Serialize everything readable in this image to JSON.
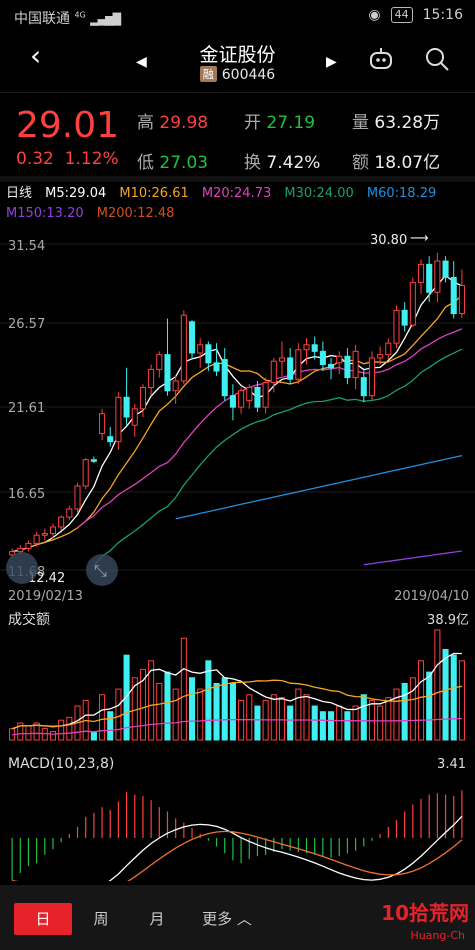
{
  "status": {
    "carrier": "中国联通",
    "network": "4G",
    "battery": "44",
    "time": "15:16"
  },
  "header": {
    "title": "金证股份",
    "badge": "融",
    "code": "600446"
  },
  "quote": {
    "price": "29.01",
    "change": "0.32",
    "change_pct": "1.12%",
    "high_label": "高",
    "high": "29.98",
    "open_label": "开",
    "open": "27.19",
    "volume_label": "量",
    "volume": "63.28万",
    "low_label": "低",
    "low": "27.03",
    "turnover_label": "换",
    "turnover": "7.42%",
    "amount_label": "额",
    "amount": "18.07亿"
  },
  "ma_bar": {
    "period": "日线",
    "m5": "M5:29.04",
    "m10": "M10:26.61",
    "m20": "M20:24.73",
    "m30": "M30:24.00",
    "m60": "M60:18.29",
    "m150": "M150:13.20",
    "m200": "M200:12.48"
  },
  "colors": {
    "m5": "#ffffff",
    "m10": "#f5a623",
    "m20": "#e040c0",
    "m30": "#18a070",
    "m60": "#2090e0",
    "m150": "#9040e0",
    "m200": "#d05020",
    "up": "#ff4040",
    "down": "#40f0f0"
  },
  "kline": {
    "y_ticks": [
      "31.54",
      "26.57",
      "21.61",
      "16.65",
      "11.68"
    ],
    "low_label": "12.42",
    "high_label": "30.80",
    "date_start": "2019/02/13",
    "date_end": "2019/04/10"
  },
  "volume_panel": {
    "title": "成交额",
    "max_label": "38.9亿"
  },
  "macd_panel": {
    "title": "MACD(10,23,8)",
    "value": "3.41"
  },
  "chart_data": {
    "type": "candlestick",
    "y_range": [
      11.68,
      31.54
    ],
    "candles": [
      {
        "o": 12.6,
        "h": 13.0,
        "l": 12.42,
        "c": 12.8
      },
      {
        "o": 12.8,
        "h": 13.2,
        "l": 12.6,
        "c": 13.0
      },
      {
        "o": 13.0,
        "h": 13.5,
        "l": 12.8,
        "c": 13.3
      },
      {
        "o": 13.3,
        "h": 14.0,
        "l": 13.1,
        "c": 13.8
      },
      {
        "o": 13.8,
        "h": 14.2,
        "l": 13.5,
        "c": 13.9
      },
      {
        "o": 13.9,
        "h": 14.5,
        "l": 13.6,
        "c": 14.3
      },
      {
        "o": 14.3,
        "h": 15.0,
        "l": 14.1,
        "c": 14.9
      },
      {
        "o": 14.9,
        "h": 15.6,
        "l": 14.7,
        "c": 15.4
      },
      {
        "o": 15.4,
        "h": 17.0,
        "l": 15.2,
        "c": 16.8
      },
      {
        "o": 16.8,
        "h": 18.5,
        "l": 16.6,
        "c": 18.4
      },
      {
        "o": 18.4,
        "h": 18.6,
        "l": 18.2,
        "c": 18.3
      },
      {
        "o": 20.0,
        "h": 21.5,
        "l": 19.6,
        "c": 21.2
      },
      {
        "o": 19.8,
        "h": 20.4,
        "l": 19.2,
        "c": 19.5
      },
      {
        "o": 19.5,
        "h": 22.5,
        "l": 19.0,
        "c": 22.2
      },
      {
        "o": 22.2,
        "h": 24.0,
        "l": 20.5,
        "c": 21.0
      },
      {
        "o": 20.5,
        "h": 21.8,
        "l": 19.8,
        "c": 21.5
      },
      {
        "o": 21.5,
        "h": 23.0,
        "l": 21.0,
        "c": 22.8
      },
      {
        "o": 22.8,
        "h": 24.2,
        "l": 22.3,
        "c": 23.9
      },
      {
        "o": 23.9,
        "h": 25.0,
        "l": 23.4,
        "c": 24.8
      },
      {
        "o": 24.8,
        "h": 27.0,
        "l": 22.3,
        "c": 22.6
      },
      {
        "o": 22.6,
        "h": 23.5,
        "l": 21.8,
        "c": 23.2
      },
      {
        "o": 23.2,
        "h": 27.5,
        "l": 23.0,
        "c": 27.2
      },
      {
        "o": 26.8,
        "h": 26.9,
        "l": 24.5,
        "c": 24.9
      },
      {
        "o": 24.9,
        "h": 25.8,
        "l": 24.0,
        "c": 25.4
      },
      {
        "o": 25.4,
        "h": 25.6,
        "l": 23.8,
        "c": 24.3
      },
      {
        "o": 24.3,
        "h": 25.5,
        "l": 23.5,
        "c": 23.8
      },
      {
        "o": 24.5,
        "h": 25.2,
        "l": 22.0,
        "c": 22.3
      },
      {
        "o": 22.3,
        "h": 23.0,
        "l": 20.8,
        "c": 21.6
      },
      {
        "o": 21.6,
        "h": 22.8,
        "l": 21.2,
        "c": 22.6
      },
      {
        "o": 22.0,
        "h": 23.0,
        "l": 21.5,
        "c": 22.8
      },
      {
        "o": 22.8,
        "h": 23.2,
        "l": 21.3,
        "c": 21.6
      },
      {
        "o": 21.6,
        "h": 23.4,
        "l": 21.2,
        "c": 23.1
      },
      {
        "o": 23.1,
        "h": 24.6,
        "l": 22.5,
        "c": 24.4
      },
      {
        "o": 24.4,
        "h": 25.6,
        "l": 23.5,
        "c": 24.6
      },
      {
        "o": 24.6,
        "h": 25.2,
        "l": 23.0,
        "c": 23.3
      },
      {
        "o": 23.3,
        "h": 25.5,
        "l": 23.0,
        "c": 25.1
      },
      {
        "o": 25.1,
        "h": 25.8,
        "l": 24.2,
        "c": 25.4
      },
      {
        "o": 25.4,
        "h": 25.9,
        "l": 24.5,
        "c": 25.0
      },
      {
        "o": 25.0,
        "h": 25.6,
        "l": 23.8,
        "c": 24.2
      },
      {
        "o": 24.2,
        "h": 24.6,
        "l": 23.3,
        "c": 24.0
      },
      {
        "o": 24.3,
        "h": 25.0,
        "l": 23.6,
        "c": 24.7
      },
      {
        "o": 24.7,
        "h": 25.2,
        "l": 23.0,
        "c": 23.4
      },
      {
        "o": 23.4,
        "h": 25.4,
        "l": 22.7,
        "c": 25.0
      },
      {
        "o": 23.4,
        "h": 24.0,
        "l": 21.9,
        "c": 22.3
      },
      {
        "o": 22.3,
        "h": 25.0,
        "l": 22.0,
        "c": 24.6
      },
      {
        "o": 24.6,
        "h": 25.3,
        "l": 24.2,
        "c": 24.8
      },
      {
        "o": 24.8,
        "h": 25.8,
        "l": 24.5,
        "c": 25.5
      },
      {
        "o": 25.5,
        "h": 27.8,
        "l": 25.2,
        "c": 27.5
      },
      {
        "o": 27.5,
        "h": 28.0,
        "l": 26.2,
        "c": 26.6
      },
      {
        "o": 26.6,
        "h": 29.5,
        "l": 26.5,
        "c": 29.2
      },
      {
        "o": 29.2,
        "h": 30.6,
        "l": 28.5,
        "c": 30.3
      },
      {
        "o": 30.3,
        "h": 30.8,
        "l": 28.0,
        "c": 28.6
      },
      {
        "o": 28.6,
        "h": 31.0,
        "l": 28.0,
        "c": 30.5
      },
      {
        "o": 30.5,
        "h": 30.8,
        "l": 29.2,
        "c": 29.5
      },
      {
        "o": 29.5,
        "h": 30.5,
        "l": 27.0,
        "c": 27.3
      },
      {
        "o": 27.3,
        "h": 29.98,
        "l": 27.03,
        "c": 29.01
      }
    ],
    "volume_max": 38.9,
    "volume": [
      4,
      6,
      5,
      6,
      4,
      3,
      7,
      8,
      12,
      14,
      3,
      16,
      10,
      18,
      30,
      22,
      25,
      28,
      20,
      24,
      18,
      36,
      22,
      18,
      28,
      20,
      22,
      20,
      14,
      16,
      12,
      14,
      16,
      15,
      12,
      18,
      16,
      12,
      10,
      10,
      12,
      10,
      12,
      16,
      14,
      12,
      15,
      18,
      20,
      22,
      28,
      24,
      38.9,
      32,
      30,
      28
    ],
    "macd_hist": [
      -3,
      -2.5,
      -2,
      -1.8,
      -1.2,
      -0.8,
      -0.3,
      0.3,
      0.8,
      1.5,
      1.8,
      2.2,
      2.0,
      2.6,
      3.3,
      3.1,
      3.0,
      2.7,
      2.2,
      1.9,
      1.4,
      1.1,
      0.7,
      0.3,
      -0.2,
      -0.6,
      -1.1,
      -1.6,
      -1.8,
      -1.5,
      -1.3,
      -1.2,
      -1.0,
      -0.8,
      -0.9,
      -1.0,
      -1.1,
      -1.2,
      -1.3,
      -1.4,
      -1.3,
      -1.1,
      -0.9,
      -0.6,
      -0.2,
      0.3,
      0.8,
      1.3,
      1.9,
      2.4,
      2.8,
      3.1,
      3.2,
      3.1,
      3.0,
      3.41
    ]
  },
  "nav": {
    "day": "日",
    "week": "周",
    "month": "月",
    "more": "更多",
    "watermark": "10拾荒网",
    "watermark_url": "Huang-Ch"
  }
}
